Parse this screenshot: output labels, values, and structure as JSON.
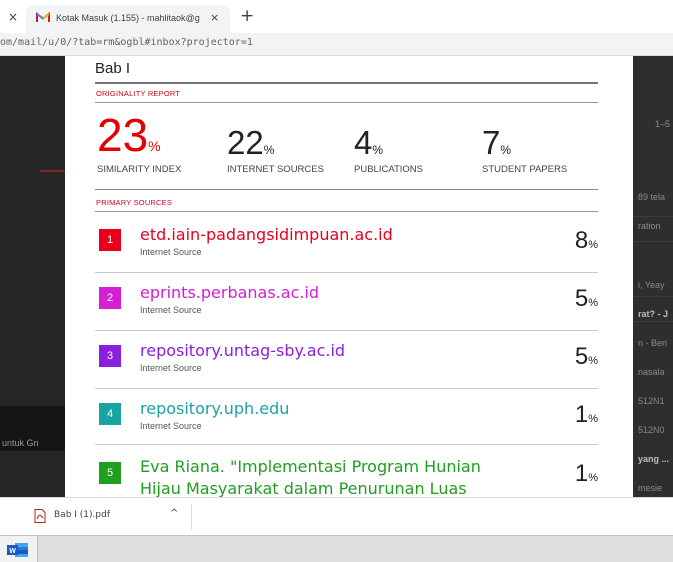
{
  "browser": {
    "tab_close_left": "×",
    "tab_title": "Kotak Masuk (1.155) - mahlitaok@g",
    "tab_close": "×",
    "new_tab": "+",
    "url": "om/mail/u/0/?tab=rm&ogbl#inbox?projector=1"
  },
  "gmail_background": {
    "snippets": [
      "1–5",
      "89 tela",
      "ration",
      "i, Yeay",
      "rat? - J",
      "n - Beri",
      "nasala",
      "512N1",
      "512N0",
      "yang ...",
      "mesie",
      "untuk Gn"
    ]
  },
  "document": {
    "title": "Bab I",
    "originality_label": "ORIGINALITY REPORT",
    "stats": [
      {
        "value": "23",
        "unit": "%",
        "label": "SIMILARITY INDEX"
      },
      {
        "value": "22",
        "unit": "%",
        "label": "INTERNET SOURCES"
      },
      {
        "value": "4",
        "unit": "%",
        "label": "PUBLICATIONS"
      },
      {
        "value": "7",
        "unit": "%",
        "label": "STUDENT PAPERS"
      }
    ],
    "primary_label": "PRIMARY SOURCES",
    "sources": [
      {
        "num": "1",
        "title": "etd.iain-padangsidimpuan.ac.id",
        "type": "Internet Source",
        "pct": "8",
        "unit": "%",
        "color": "#e8001c"
      },
      {
        "num": "2",
        "title": "eprints.perbanas.ac.id",
        "type": "Internet Source",
        "pct": "5",
        "unit": "%",
        "color": "#d41fd4"
      },
      {
        "num": "3",
        "title": "repository.untag-sby.ac.id",
        "type": "Internet Source",
        "pct": "5",
        "unit": "%",
        "color": "#8a1fe0"
      },
      {
        "num": "4",
        "title": "repository.uph.edu",
        "type": "Internet Source",
        "pct": "1",
        "unit": "%",
        "color": "#1aa3a3"
      },
      {
        "num": "5",
        "title": "Eva Riana. \"Implementasi Program Hunian",
        "title2": "Hijau Masyarakat dalam Penurunan Luas",
        "pct": "1",
        "unit": "%",
        "color": "#1f9e1f"
      }
    ]
  },
  "downloads": {
    "file_name": "Bab I (1).pdf",
    "chevron": "^"
  },
  "taskbar": {
    "app": "word-icon"
  }
}
